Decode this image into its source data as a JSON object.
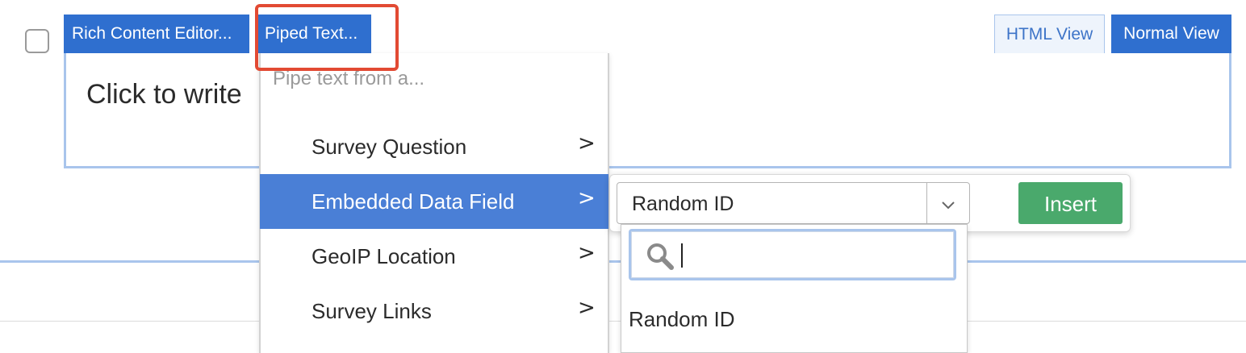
{
  "toolbar": {
    "rich_content_editor_label": "Rich Content Editor...",
    "piped_text_label": "Piped Text...",
    "html_view_label": "HTML View",
    "normal_view_label": "Normal View"
  },
  "editor": {
    "placeholder": "Click to write"
  },
  "pipe_menu": {
    "header": "Pipe text from a...",
    "items": [
      {
        "label": "Survey Question",
        "chevron": ">"
      },
      {
        "label": "Embedded Data Field",
        "chevron": ">",
        "active": true
      },
      {
        "label": "GeoIP Location",
        "chevron": ">"
      },
      {
        "label": "Survey Links",
        "chevron": ">"
      }
    ]
  },
  "embedded_data": {
    "selected_value": "Random ID",
    "arrow_icon": "chevron-down-icon",
    "insert_label": "Insert",
    "search_value": "",
    "options": [
      "Random ID"
    ]
  },
  "colors": {
    "toolbar_blue": "#2f6fcf",
    "menu_active": "#4a7fd6",
    "insert_green": "#4aa96c",
    "highlight_red": "#e24a33"
  }
}
